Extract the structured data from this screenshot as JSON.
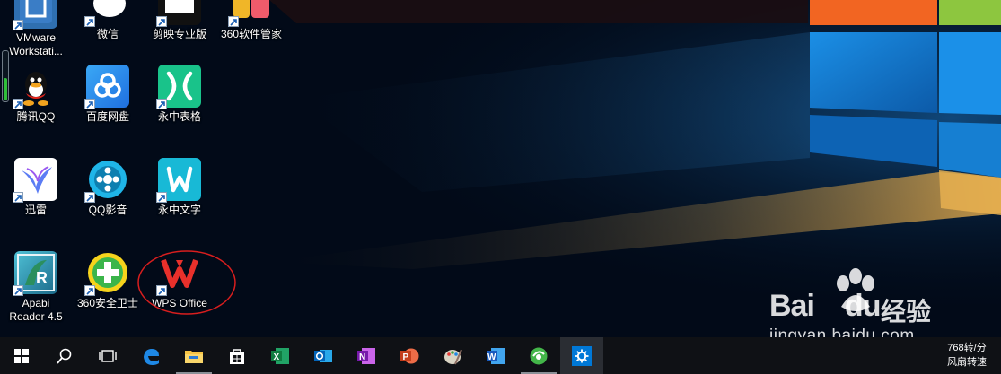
{
  "desktop": {
    "icons": [
      {
        "name": "vmware-icon",
        "label": "VMware\nWorkstati..."
      },
      {
        "name": "wechat-icon",
        "label": "微信"
      },
      {
        "name": "jianying-icon",
        "label": "剪映专业版"
      },
      {
        "name": "360-software-manager-icon",
        "label": "360软件管家"
      },
      {
        "name": "qq-icon",
        "label": "腾讯QQ"
      },
      {
        "name": "baidu-netdisk-icon",
        "label": "百度网盘"
      },
      {
        "name": "yozo-sheet-icon",
        "label": "永中表格"
      },
      {
        "name": "xunlei-icon",
        "label": "迅雷"
      },
      {
        "name": "qq-video-icon",
        "label": "QQ影音"
      },
      {
        "name": "yozo-writer-icon",
        "label": "永中文字"
      },
      {
        "name": "apabi-reader-icon",
        "label": "Apabi\nReader 4.5"
      },
      {
        "name": "360-security-icon",
        "label": "360安全卫士"
      },
      {
        "name": "wps-office-icon",
        "label": "WPS Office"
      }
    ]
  },
  "gauge": {
    "level_fraction": 0.45,
    "color": "#2fbf3a"
  },
  "watermark": {
    "logo_text": "Bai",
    "logo_text2": "du",
    "cn_text": "经验",
    "url": "jingyan.baidu.com"
  },
  "taskbar": {
    "buttons": [
      "start-icon",
      "search-icon",
      "task-view-icon",
      "edge-icon",
      "file-explorer-icon",
      "store-icon",
      "excel-icon",
      "outlook-icon",
      "onenote-icon",
      "powerpoint-icon",
      "paint-icon",
      "word-icon",
      "browser-icon",
      "settings-icon"
    ],
    "tray": {
      "line1": "768转/分",
      "line2": "风扇转速"
    }
  },
  "colors": {
    "accent_blue": "#0a84ff",
    "win_orange": "#f26522",
    "win_green": "#8dc63f",
    "annotation_red": "#d81e1e"
  }
}
